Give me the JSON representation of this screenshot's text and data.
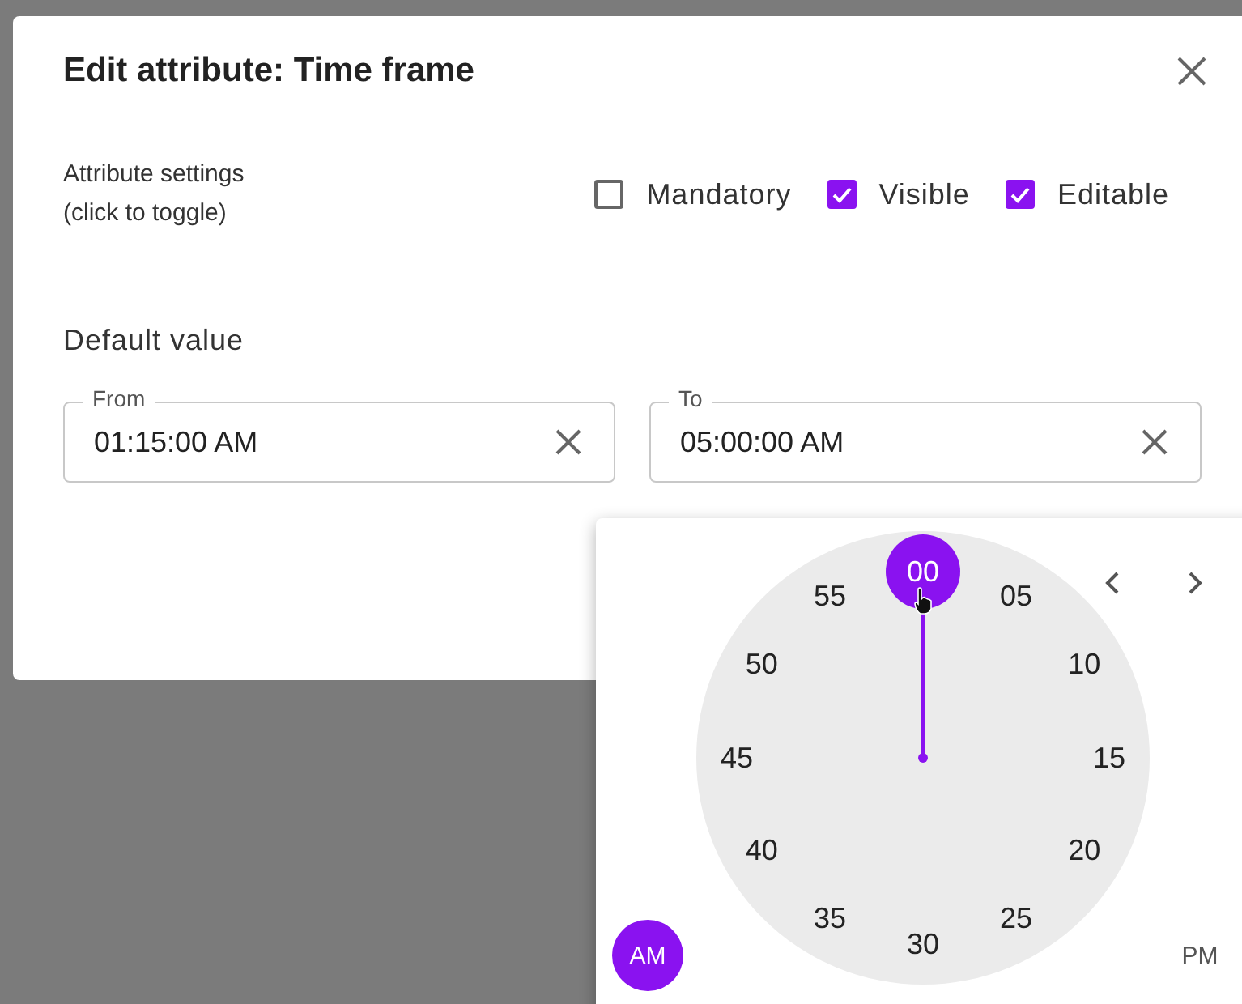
{
  "dialog": {
    "title": "Edit attribute: Time frame",
    "settings_label": "Attribute settings\n(click to toggle)",
    "checkboxes": [
      {
        "label": "Mandatory",
        "checked": false
      },
      {
        "label": "Visible",
        "checked": true
      },
      {
        "label": "Editable",
        "checked": true
      }
    ],
    "default_value_label": "Default value",
    "fields": [
      {
        "label": "From",
        "value": "01:15:00 AM"
      },
      {
        "label": "To",
        "value": "05:00:00 AM"
      }
    ]
  },
  "time_picker": {
    "minutes": [
      {
        "label": "00",
        "selected": true
      },
      {
        "label": "05",
        "selected": false
      },
      {
        "label": "10",
        "selected": false
      },
      {
        "label": "15",
        "selected": false
      },
      {
        "label": "20",
        "selected": false
      },
      {
        "label": "25",
        "selected": false
      },
      {
        "label": "30",
        "selected": false
      },
      {
        "label": "35",
        "selected": false
      },
      {
        "label": "40",
        "selected": false
      },
      {
        "label": "45",
        "selected": false
      },
      {
        "label": "50",
        "selected": false
      },
      {
        "label": "55",
        "selected": false
      }
    ],
    "periods": [
      {
        "label": "AM",
        "selected": true
      },
      {
        "label": "PM",
        "selected": false
      }
    ]
  }
}
